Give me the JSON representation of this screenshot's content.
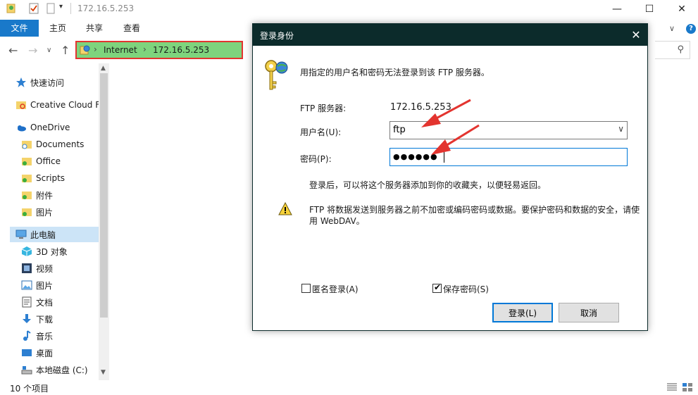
{
  "window": {
    "title": "172.16.5.253",
    "controls": {
      "minimize": "—",
      "maximize": "☐",
      "close": "✕"
    }
  },
  "ribbon": {
    "tabs": [
      "文件",
      "主页",
      "共享",
      "查看"
    ],
    "help": "?"
  },
  "address": {
    "crumbs": [
      "Internet",
      "172.16.5.253"
    ],
    "separator": "›"
  },
  "sidebar": {
    "items": [
      {
        "label": "快速访问",
        "icon": "star-icon"
      },
      {
        "label": "Creative Cloud F",
        "icon": "creative-cloud-folder-icon"
      },
      {
        "label": "OneDrive",
        "icon": "onedrive-cloud-icon"
      },
      {
        "label": "Documents",
        "icon": "folder-sync-icon"
      },
      {
        "label": "Office",
        "icon": "folder-synced-icon"
      },
      {
        "label": "Scripts",
        "icon": "folder-synced-icon"
      },
      {
        "label": "附件",
        "icon": "folder-synced-icon"
      },
      {
        "label": "图片",
        "icon": "folder-synced-icon"
      },
      {
        "label": "此电脑",
        "icon": "computer-icon"
      },
      {
        "label": "3D 对象",
        "icon": "3d-objects-icon"
      },
      {
        "label": "视频",
        "icon": "video-icon"
      },
      {
        "label": "图片",
        "icon": "pictures-icon"
      },
      {
        "label": "文档",
        "icon": "documents-icon"
      },
      {
        "label": "下载",
        "icon": "download-icon"
      },
      {
        "label": "音乐",
        "icon": "music-icon"
      },
      {
        "label": "桌面",
        "icon": "desktop-icon"
      },
      {
        "label": "本地磁盘 (C:)",
        "icon": "drive-icon"
      }
    ]
  },
  "status": {
    "item_count": "10 个项目"
  },
  "dialog": {
    "title": "登录身份",
    "intro": "用指定的用户名和密码无法登录到该 FTP 服务器。",
    "server_label": "FTP 服务器:",
    "server_value": "172.16.5.253",
    "username_label": "用户名(U):",
    "username_value": "ftp",
    "password_label": "密码(P):",
    "password_value": "●●●●●●",
    "favorites_note": "登录后，可以将这个服务器添加到你的收藏夹，以便轻易返回。",
    "warning_line1": "FTP 将数据发送到服务器之前不加密或编码密码或数据。要保护密码和数据的安全，请使",
    "warning_line2": "用 WebDAV。",
    "anonymous_label": "匿名登录(A)",
    "anonymous_checked": false,
    "save_password_label": "保存密码(S)",
    "save_password_checked": true,
    "login_button": "登录(L)",
    "cancel_button": "取消"
  },
  "colors": {
    "file_tab": "#1979ca",
    "dialog_titlebar": "#0c2b2b",
    "address_highlight": "#7ed47d",
    "annotation_red": "#e3342f",
    "focus_blue": "#0078d7"
  }
}
